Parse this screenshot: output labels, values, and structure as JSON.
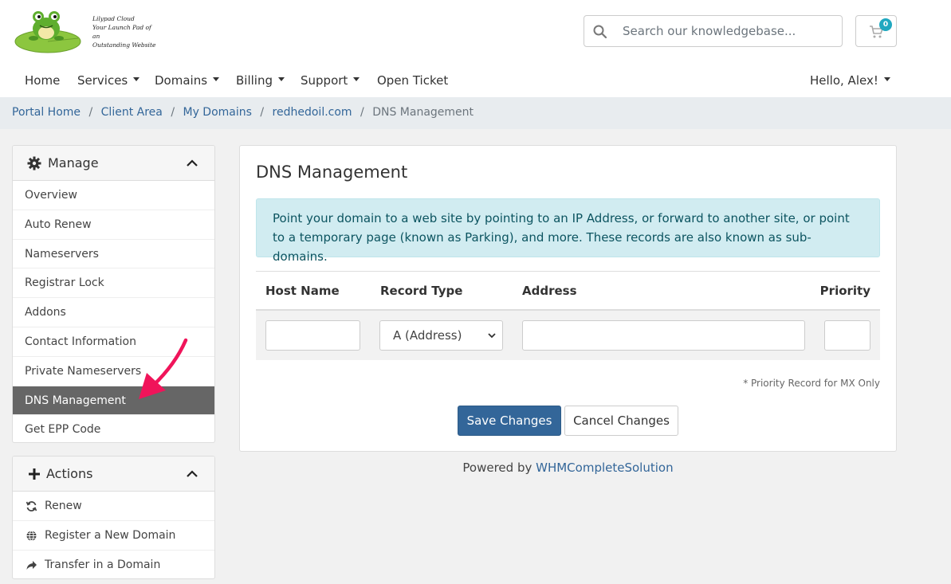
{
  "brand": {
    "logo_lines": [
      "Lilypad Cloud",
      "Your Launch Pad  of an",
      "Outstanding Website"
    ]
  },
  "header": {
    "search_placeholder": "Search our knowledgebase...",
    "cart_count": "0"
  },
  "nav": {
    "items": [
      "Home",
      "Services",
      "Domains",
      "Billing",
      "Support",
      "Open Ticket"
    ],
    "user_greeting": "Hello, Alex!"
  },
  "breadcrumb": {
    "items": [
      "Portal Home",
      "Client Area",
      "My Domains",
      "redhedoil.com"
    ],
    "active": "DNS Management",
    "separator": "/"
  },
  "sidebar": {
    "manage": {
      "title": "Manage",
      "items": [
        "Overview",
        "Auto Renew",
        "Nameservers",
        "Registrar Lock",
        "Addons",
        "Contact Information",
        "Private Nameservers",
        "DNS Management",
        "Get EPP Code"
      ],
      "active_item": "DNS Management"
    },
    "actions": {
      "title": "Actions",
      "items": [
        "Renew",
        "Register a New Domain",
        "Transfer in a Domain"
      ]
    }
  },
  "main": {
    "title": "DNS Management",
    "info_text": "Point your domain to a web site by pointing to an IP Address, or forward to another site, or point to a temporary page (known as Parking), and more. These records are also known as sub-domains.",
    "table": {
      "headers": [
        "Host Name",
        "Record Type",
        "Address",
        "Priority"
      ],
      "record_type_selected": "A (Address)",
      "host_value": "",
      "address_value": "",
      "priority_value": ""
    },
    "priority_note": "* Priority Record for MX Only",
    "save_label": "Save Changes",
    "cancel_label": "Cancel Changes"
  },
  "footer": {
    "prefix": "Powered by ",
    "link": "WHMCompleteSolution"
  },
  "colors": {
    "link": "#336699",
    "primary": "#336699",
    "active_item_bg": "#666666",
    "alert_bg": "#d1ecf1",
    "badge": "#20a8c0",
    "annotation_arrow": "#f0145a"
  }
}
